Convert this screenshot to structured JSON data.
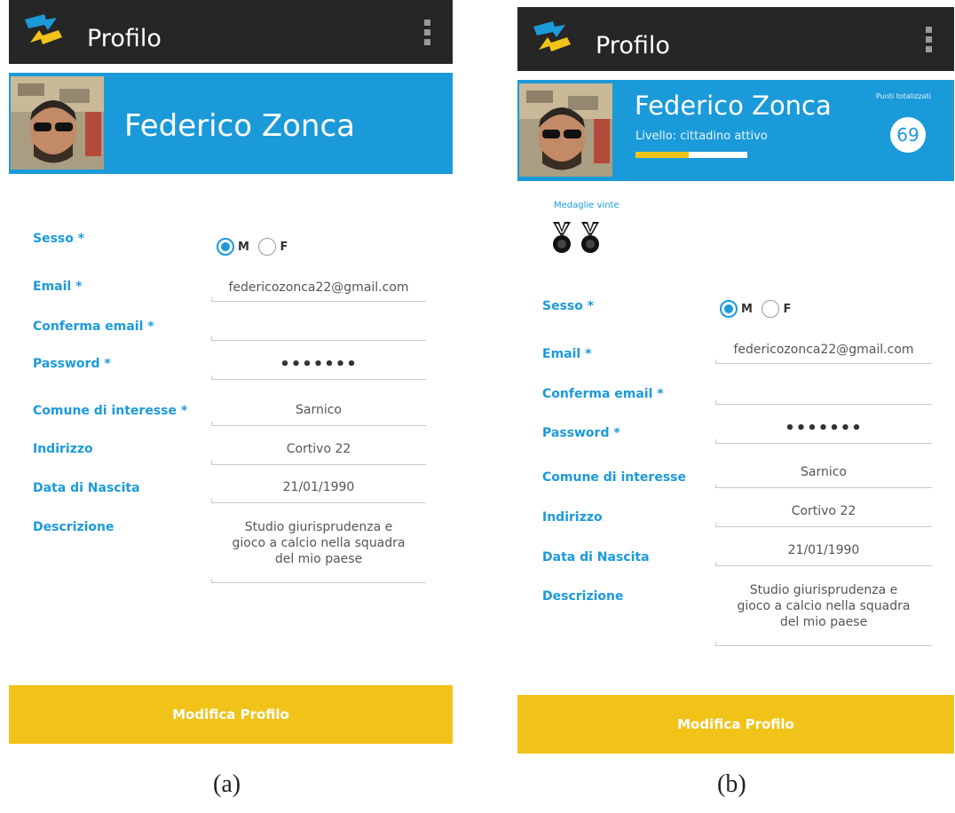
{
  "screen_a": {
    "app_title": "Profilo",
    "user_name": "Federico Zonca",
    "form": {
      "sesso_label": "Sesso *",
      "radio_m": "M",
      "radio_f": "F",
      "email_label": "Email *",
      "email_value": "federicozonca22@gmail.com",
      "confirm_email_label": "Conferma email *",
      "confirm_email_value": "",
      "password_label": "Password *",
      "password_value": "•••••••",
      "comune_label": "Comune di interesse *",
      "comune_value": "Sarnico",
      "indirizzo_label": "Indirizzo",
      "indirizzo_value": "Cortivo 22",
      "data_label": "Data di Nascita",
      "data_value": "21/01/1990",
      "descrizione_label": "Descrizione",
      "descrizione_value": "Studio giurisprudenza e gioco a calcio nella squadra del mio paese"
    },
    "button_label": "Modifica Profilo",
    "caption": "(a)"
  },
  "screen_b": {
    "app_title": "Profilo",
    "user_name": "Federico Zonca",
    "level_text": "Livello: cittadino attivo",
    "level_progress": 0.48,
    "points_label": "Punti totalizzati",
    "points_value": "69",
    "medals_label": "Medaglie vinte",
    "medal_count": 2,
    "form": {
      "sesso_label": "Sesso *",
      "radio_m": "M",
      "radio_f": "F",
      "email_label": "Email *",
      "email_value": "federicozonca22@gmail.com",
      "confirm_email_label": "Conferma email *",
      "confirm_email_value": "",
      "password_label": "Password *",
      "password_value": "•••••••",
      "comune_label": "Comune di interesse",
      "comune_value": "Sarnico",
      "indirizzo_label": "Indirizzo",
      "indirizzo_value": "Cortivo 22",
      "data_label": "Data di Nascita",
      "data_value": "21/01/1990",
      "descrizione_label": "Descrizione",
      "descrizione_value": "Studio giurisprudenza e gioco a calcio nella squadra del mio paese"
    },
    "button_label": "Modifica Profilo",
    "caption": "(b)"
  },
  "colors": {
    "appbar": "#262626",
    "accent_blue": "#1b9ad9",
    "button_yellow": "#f1c319"
  },
  "icons": [
    "app-logo-icon",
    "overflow-menu-icon",
    "medal-icon"
  ]
}
